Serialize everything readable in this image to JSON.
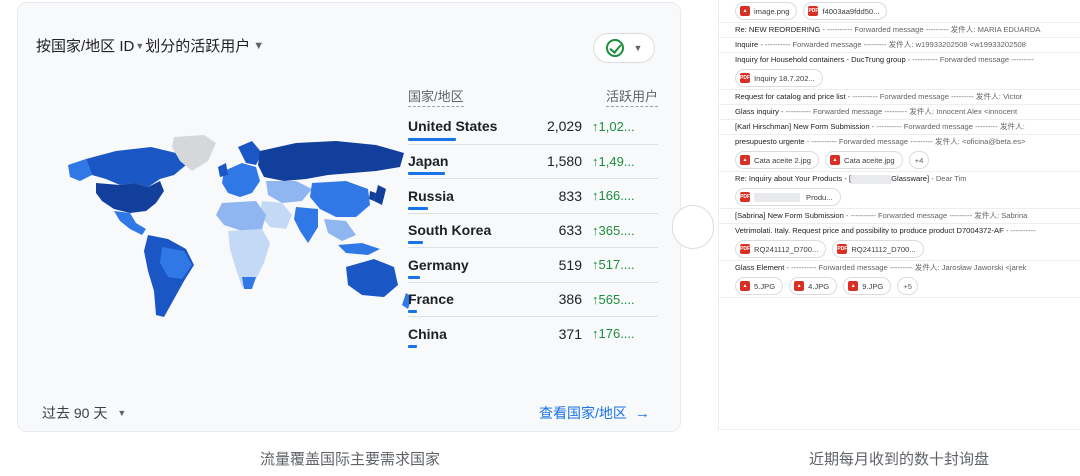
{
  "analytics": {
    "title_part1": "按国家/地区 ID",
    "title_part2": "划分的活跃用户",
    "col_country": "国家/地区",
    "col_users": "活跃用户",
    "rows": [
      {
        "country": "United States",
        "users": "2,029",
        "delta": "↑1,02...",
        "share": 1.0
      },
      {
        "country": "Japan",
        "users": "1,580",
        "delta": "↑1,49...",
        "share": 0.78
      },
      {
        "country": "Russia",
        "users": "833",
        "delta": "↑166....",
        "share": 0.41
      },
      {
        "country": "South Korea",
        "users": "633",
        "delta": "↑365....",
        "share": 0.31
      },
      {
        "country": "Germany",
        "users": "519",
        "delta": "↑517....",
        "share": 0.26
      },
      {
        "country": "France",
        "users": "386",
        "delta": "↑565....",
        "share": 0.19
      },
      {
        "country": "China",
        "users": "371",
        "delta": "↑176....",
        "share": 0.18
      }
    ],
    "period_label": "过去 90 天",
    "view_link": "查看国家/地区",
    "map_colors": {
      "dark": "#1a56c4",
      "mid": "#2f78e6",
      "light": "#8fb6f0",
      "pale": "#c4d9f6",
      "none": "#d5d7da"
    }
  },
  "caption_left": "流量覆盖国际主要需求国家",
  "caption_right": "近期每月收到的数十封询盘",
  "emails": [
    {
      "kind": "chips",
      "chips": [
        "image.png",
        "f4003aa9fdd50..."
      ]
    },
    {
      "kind": "line",
      "subject": "Re: NEW REORDERING",
      "rest": " - ---------- Forwarded message --------- 发件人:  MARIA EDUARDA"
    },
    {
      "kind": "line",
      "subject": "Inquire",
      "rest": " - ---------- Forwarded message --------- 发件人:  w19933202508 <w19933202508"
    },
    {
      "kind": "line",
      "subject": "Inquiry for Household containers - DucTrung group",
      "rest": " - ---------- Forwarded message ---------"
    },
    {
      "kind": "chips",
      "chips": [
        "Inquiry 18.7.202..."
      ]
    },
    {
      "kind": "line",
      "subject": "Request for catalog and price list",
      "rest": " - ---------- Forwarded message --------- 发件人:  Victor"
    },
    {
      "kind": "line",
      "subject": "Glass inquiry",
      "rest": " - ---------- Forwarded message --------- 发件人:  Innocent Alex <innocent"
    },
    {
      "kind": "line",
      "subject": "[Karl Hirschman] New Form Submission",
      "rest": " - ---------- Forwarded message --------- 发件人:"
    },
    {
      "kind": "line",
      "subject": "presupuesto urgente",
      "rest": " - ---------- Forwarded message --------- 发件人:  <oficina@beta.es>"
    },
    {
      "kind": "chips",
      "chips": [
        "Cata aceite 2.jpg",
        "Cata aceite.jpg"
      ],
      "more": "+4"
    },
    {
      "kind": "line",
      "subject": "Re: Inquiry about Your Products - [",
      "redacted": true,
      "subject_end": "Glassware]",
      "rest": " - Dear Tim"
    },
    {
      "kind": "chips_redacted",
      "chips": [
        "Produ..."
      ]
    },
    {
      "kind": "line",
      "subject": "[Sabrina] New Form Submission",
      "rest": " - ---------- Forwarded message --------- 发件人:  Sabrina"
    },
    {
      "kind": "line",
      "subject": "Vetrimolati. Italy. Request price and possibility to produce product D7004372-AF",
      "rest": " - ----------"
    },
    {
      "kind": "chips",
      "chips": [
        "RQ241112_D700...",
        "RQ241112_D700..."
      ]
    },
    {
      "kind": "line",
      "subject": "Glass Element",
      "rest": " - ---------- Forwarded message --------- 发件人:  Jarosław Jaworski <jarek"
    },
    {
      "kind": "chips",
      "chips": [
        "5.JPG",
        "4.JPG",
        "9.JPG"
      ],
      "more": "+5"
    }
  ]
}
